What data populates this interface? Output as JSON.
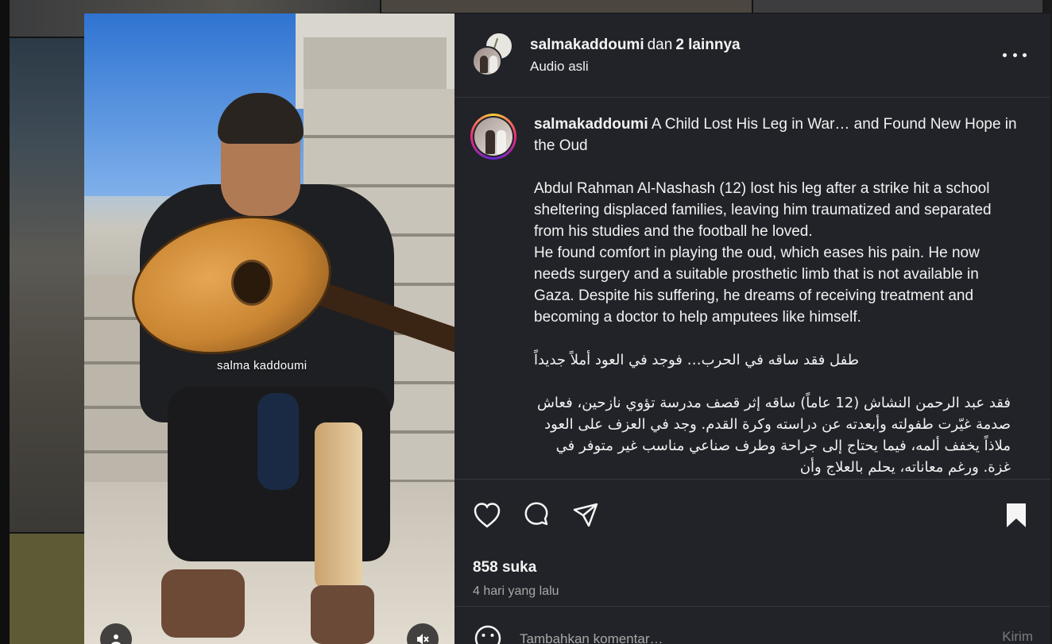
{
  "header": {
    "username": "salmakaddoumi",
    "connector": "dan",
    "others": "2 lainnya",
    "audio": "Audio asli",
    "more_icon": "more-horizontal-icon"
  },
  "media": {
    "watermark": "salma kaddoumi",
    "tag_icon": "person-tag-icon",
    "mute_icon": "speaker-muted-icon"
  },
  "caption": {
    "username": "salmakaddoumi",
    "title": "A Child Lost His Leg in War… and Found New Hope in the Oud",
    "para1": "Abdul Rahman Al-Nashash (12) lost his leg after a strike hit a school sheltering displaced families, leaving him traumatized and separated from his studies and the football he loved.",
    "para2": "He found comfort in playing the oud, which eases his pain. He now needs surgery and a suitable prosthetic limb that is not available in Gaza. Despite his suffering, he dreams of receiving treatment and becoming a doctor to help amputees like himself.",
    "arabic_title": "طفل فقد ساقه في الحرب… فوجد في العود أملاً جديداً",
    "arabic_body": "فقد عبد الرحمن النشاش (12 عاماً) ساقه إثر قصف مدرسة تؤوي نازحين، فعاش صدمة غيّرت طفولته وأبعدته عن دراسته وكرة القدم. وجد في العزف على العود ملاذاً يخفف ألمه، فيما يحتاج إلى جراحة وطرف صناعي مناسب غير متوفر في غزة. ورغم معاناته، يحلم بالعلاج وأن"
  },
  "actions": {
    "like_icon": "heart-icon",
    "comment_icon": "comment-icon",
    "share_icon": "share-icon",
    "save_icon": "bookmark-icon",
    "likes": "858 suka",
    "time": "4 hari yang lalu"
  },
  "comment": {
    "placeholder": "Tambahkan komentar…",
    "send": "Kirim",
    "emoji_icon": "emoji-icon"
  },
  "colors": {
    "panel_bg": "#212328",
    "text": "#f5f5f5",
    "muted": "#a8a8a8",
    "divider": "#34363b"
  }
}
